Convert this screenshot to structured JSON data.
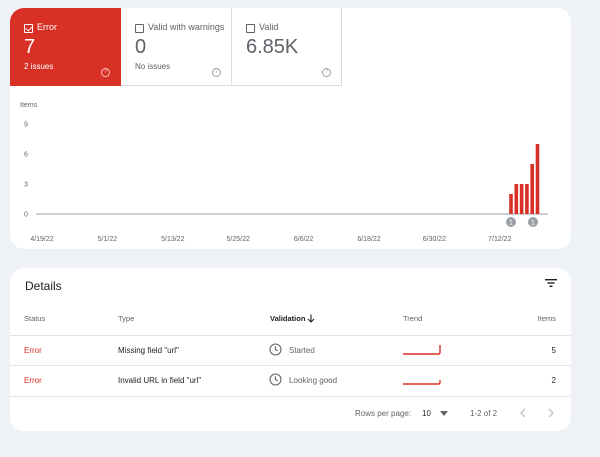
{
  "summary": {
    "error": {
      "label": "Error",
      "value": "7",
      "sub": "2 issues"
    },
    "warning": {
      "label": "Valid with warnings",
      "value": "0",
      "sub": "No issues"
    },
    "valid": {
      "label": "Valid",
      "value": "6.85K"
    }
  },
  "chart_data": {
    "type": "bar",
    "ylabel": "Items",
    "ylim": [
      0,
      9
    ],
    "yticks": [
      "9",
      "6",
      "3",
      "0"
    ],
    "xticks": [
      "4/19/22",
      "5/1/22",
      "5/13/22",
      "5/25/22",
      "6/6/22",
      "6/18/22",
      "6/30/22",
      "7/12/22"
    ],
    "values": [
      2,
      3,
      3,
      3,
      5,
      7
    ],
    "bar_color": "#d93025",
    "annotations": [
      "1",
      "1"
    ]
  },
  "details": {
    "title": "Details",
    "columns": {
      "status": "Status",
      "type": "Type",
      "validation": "Validation",
      "trend": "Trend",
      "items": "Items"
    },
    "rows": [
      {
        "status": "Error",
        "type": "Missing field \"url\"",
        "validation": "Started",
        "items": "5"
      },
      {
        "status": "Error",
        "type": "Invalid URL in field \"url\"",
        "validation": "Looking good",
        "items": "2"
      }
    ],
    "footer": {
      "rows_per_page_label": "Rows per page:",
      "rows_per_page": "10",
      "range": "1-2 of 2"
    }
  },
  "colors": {
    "error": "#d93025",
    "background": "#eef1f6"
  }
}
